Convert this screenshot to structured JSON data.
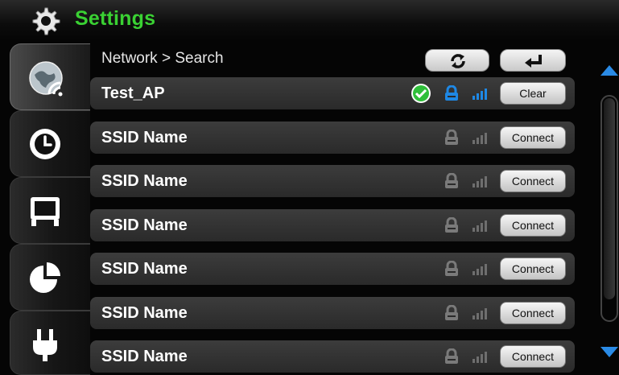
{
  "header": {
    "title": "Settings",
    "icon": "gear-icon"
  },
  "tabs": [
    {
      "name": "network",
      "icon": "globe-wifi-icon",
      "active": true
    },
    {
      "name": "clock",
      "icon": "clock-icon",
      "active": false
    },
    {
      "name": "display",
      "icon": "monitor-icon",
      "active": false
    },
    {
      "name": "storage",
      "icon": "pie-chart-icon",
      "active": false
    },
    {
      "name": "power",
      "icon": "plug-icon",
      "active": false
    }
  ],
  "breadcrumb": "Network > Search",
  "toolbar": {
    "refresh_icon": "refresh-icon",
    "back_icon": "return-icon"
  },
  "networks": [
    {
      "ssid": "Test_AP",
      "action": "Clear",
      "connected": true,
      "secured": true
    },
    {
      "ssid": "SSID Name",
      "action": "Connect",
      "connected": false,
      "secured": true
    },
    {
      "ssid": "SSID Name",
      "action": "Connect",
      "connected": false,
      "secured": true
    },
    {
      "ssid": "SSID Name",
      "action": "Connect",
      "connected": false,
      "secured": true
    },
    {
      "ssid": "SSID Name",
      "action": "Connect",
      "connected": false,
      "secured": true
    },
    {
      "ssid": "SSID Name",
      "action": "Connect",
      "connected": false,
      "secured": true
    },
    {
      "ssid": "SSID Name",
      "action": "Connect",
      "connected": false,
      "secured": true
    }
  ],
  "colors": {
    "title_green": "#3ad133",
    "accent_blue": "#1e88e5",
    "check_green": "#2fbf3a"
  }
}
